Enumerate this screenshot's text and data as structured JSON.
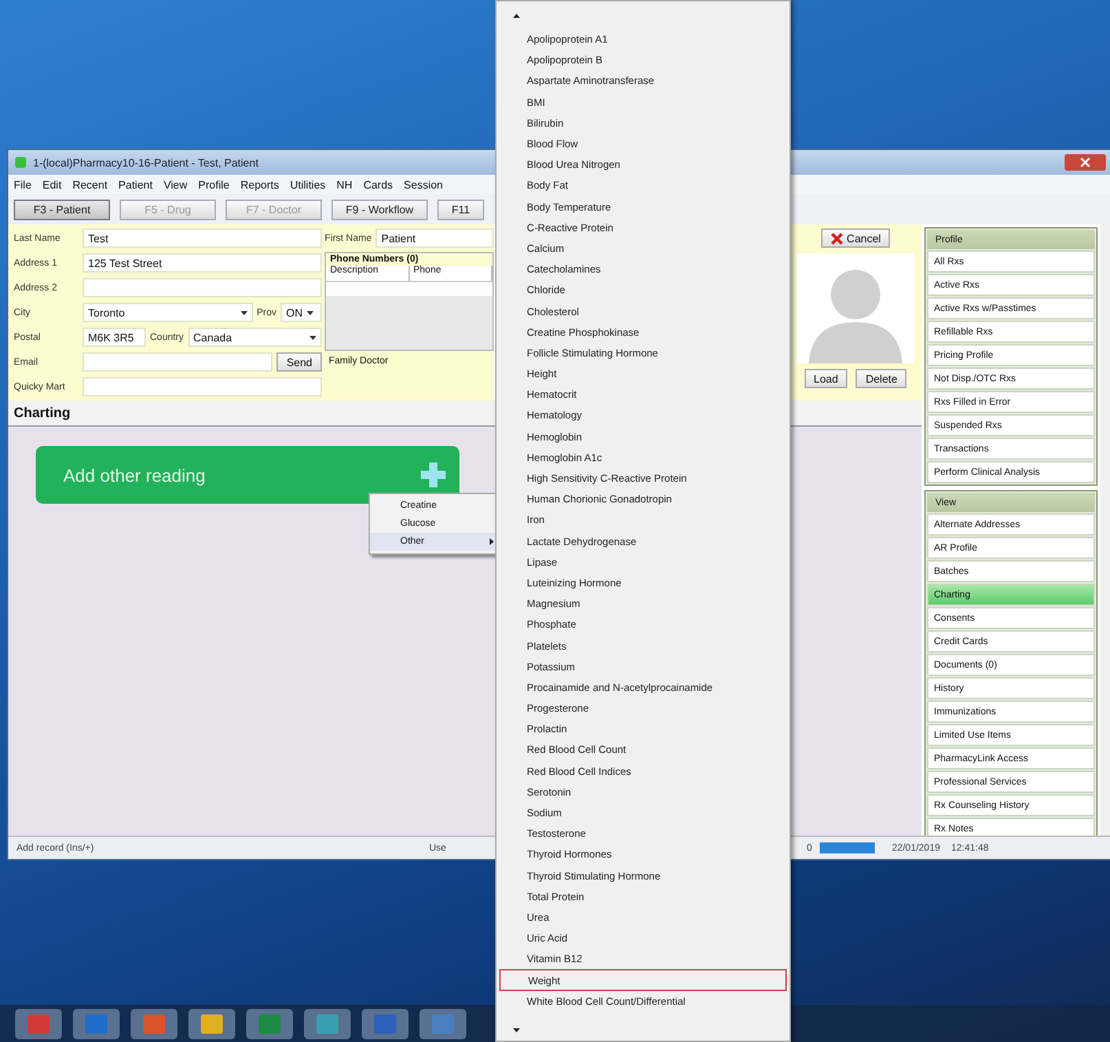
{
  "window": {
    "title": "1-(local)Pharmacy10-16-Patient - Test, Patient"
  },
  "menu_bar": [
    "File",
    "Edit",
    "Recent",
    "Patient",
    "View",
    "Profile",
    "Reports",
    "Utilities",
    "NH",
    "Cards",
    "Session"
  ],
  "toolbar_tabs": [
    {
      "label": "F3 - Patient",
      "selected": true,
      "disabled": false
    },
    {
      "label": "F5 - Drug",
      "selected": false,
      "disabled": true
    },
    {
      "label": "F7 - Doctor",
      "selected": false,
      "disabled": true
    },
    {
      "label": "F9 - Workflow",
      "selected": false,
      "disabled": false
    },
    {
      "label": "F11",
      "selected": false,
      "disabled": false
    }
  ],
  "patient_form": {
    "last_name": {
      "label": "Last Name",
      "value": "Test"
    },
    "first_name": {
      "label": "First Name",
      "value": "Patient"
    },
    "address_1": {
      "label": "Address 1",
      "value": "125 Test Street"
    },
    "address_2": {
      "label": "Address 2"
    },
    "city": {
      "label": "City",
      "value": "Toronto"
    },
    "province": {
      "label": "Prov",
      "value": "ON"
    },
    "postal": {
      "label": "Postal",
      "value": "M6K 3R5"
    },
    "country": {
      "label": "Country",
      "value": "Canada"
    },
    "email": {
      "label": "Email"
    },
    "send_button": "Send",
    "quicky_mart": {
      "label": "Quicky Mart"
    }
  },
  "phone_numbers": {
    "title": "Phone Numbers (0)",
    "columns": [
      "Description",
      "Phone"
    ]
  },
  "family_doctor": {
    "label": "Family Doctor"
  },
  "photo_panel": {
    "cancel_button": "Cancel",
    "load_button": "Load",
    "delete_button": "Delete"
  },
  "charting": {
    "title": "Charting",
    "add_card": {
      "label": "Add other reading"
    },
    "context_menu": [
      {
        "label": "Creatine",
        "submenu": false,
        "selected": false
      },
      {
        "label": "Glucose",
        "submenu": false,
        "selected": false
      },
      {
        "label": "Other",
        "submenu": true,
        "selected": true
      }
    ]
  },
  "sidebar": {
    "groups": [
      {
        "title": "Profile",
        "items": [
          {
            "label": "All Rxs",
            "selected": false
          },
          {
            "label": "Active Rxs",
            "selected": false
          },
          {
            "label": "Active Rxs w/Passtimes",
            "selected": false
          },
          {
            "label": "Refillable Rxs",
            "selected": false
          },
          {
            "label": "Pricing Profile",
            "selected": false
          },
          {
            "label": "Not Disp./OTC Rxs",
            "selected": false
          },
          {
            "label": "Rxs Filled in Error",
            "selected": false
          },
          {
            "label": "Suspended Rxs",
            "selected": false
          },
          {
            "label": "Transactions",
            "selected": false
          },
          {
            "label": "Perform Clinical Analysis",
            "selected": false
          }
        ]
      },
      {
        "title": "View",
        "items": [
          {
            "label": "Alternate Addresses",
            "selected": false
          },
          {
            "label": "AR Profile",
            "selected": false
          },
          {
            "label": "Batches",
            "selected": false
          },
          {
            "label": "Charting",
            "selected": true
          },
          {
            "label": "Consents",
            "selected": false
          },
          {
            "label": "Credit Cards",
            "selected": false
          },
          {
            "label": "Documents (0)",
            "selected": false
          },
          {
            "label": "History",
            "selected": false
          },
          {
            "label": "Immunizations",
            "selected": false
          },
          {
            "label": "Limited Use Items",
            "selected": false
          },
          {
            "label": "PharmacyLink Access",
            "selected": false
          },
          {
            "label": "Professional Services",
            "selected": false
          },
          {
            "label": "Rx Counseling History",
            "selected": false
          },
          {
            "label": "Rx Notes",
            "selected": false
          }
        ]
      }
    ]
  },
  "status_bar": {
    "hint": "Add record (Ins/+)",
    "user": "Use",
    "count": "0",
    "level": 1,
    "date": "22/01/2019",
    "time": "12:41:48"
  },
  "dropdown_list": {
    "items": [
      {
        "label": "Apolipoprotein A1",
        "selected": false
      },
      {
        "label": "Apolipoprotein B",
        "selected": false
      },
      {
        "label": "Aspartate Aminotransferase",
        "selected": false
      },
      {
        "label": "BMI",
        "selected": false
      },
      {
        "label": "Bilirubin",
        "selected": false
      },
      {
        "label": "Blood Flow",
        "selected": false
      },
      {
        "label": "Blood Urea Nitrogen",
        "selected": false
      },
      {
        "label": "Body Fat",
        "selected": false
      },
      {
        "label": "Body Temperature",
        "selected": false
      },
      {
        "label": "C-Reactive Protein",
        "selected": false
      },
      {
        "label": "Calcium",
        "selected": false
      },
      {
        "label": "Catecholamines",
        "selected": false
      },
      {
        "label": "Chloride",
        "selected": false
      },
      {
        "label": "Cholesterol",
        "selected": false
      },
      {
        "label": "Creatine Phosphokinase",
        "selected": false
      },
      {
        "label": "Follicle Stimulating Hormone",
        "selected": false
      },
      {
        "label": "Height",
        "selected": false
      },
      {
        "label": "Hematocrit",
        "selected": false
      },
      {
        "label": "Hematology",
        "selected": false
      },
      {
        "label": "Hemoglobin",
        "selected": false
      },
      {
        "label": "Hemoglobin A1c",
        "selected": false
      },
      {
        "label": "High Sensitivity C-Reactive Protein",
        "selected": false
      },
      {
        "label": "Human Chorionic Gonadotropin",
        "selected": false
      },
      {
        "label": "Iron",
        "selected": false
      },
      {
        "label": "Lactate Dehydrogenase",
        "selected": false
      },
      {
        "label": "Lipase",
        "selected": false
      },
      {
        "label": "Luteinizing Hormone",
        "selected": false
      },
      {
        "label": "Magnesium",
        "selected": false
      },
      {
        "label": "Phosphate",
        "selected": false
      },
      {
        "label": "Platelets",
        "selected": false
      },
      {
        "label": "Potassium",
        "selected": false
      },
      {
        "label": "Procainamide and N-acetylprocainamide",
        "selected": false
      },
      {
        "label": "Progesterone",
        "selected": false
      },
      {
        "label": "Prolactin",
        "selected": false
      },
      {
        "label": "Red Blood Cell Count",
        "selected": false
      },
      {
        "label": "Red Blood Cell Indices",
        "selected": false
      },
      {
        "label": "Serotonin",
        "selected": false
      },
      {
        "label": "Sodium",
        "selected": false
      },
      {
        "label": "Testosterone",
        "selected": false
      },
      {
        "label": "Thyroid Hormones",
        "selected": false
      },
      {
        "label": "Thyroid Stimulating Hormone",
        "selected": false
      },
      {
        "label": "Total Protein",
        "selected": false
      },
      {
        "label": "Urea",
        "selected": false
      },
      {
        "label": "Uric Acid",
        "selected": false
      },
      {
        "label": "Vitamin B12",
        "selected": false
      },
      {
        "label": "Weight",
        "selected": true
      },
      {
        "label": "White Blood Cell Count/Differential",
        "selected": false
      }
    ]
  }
}
